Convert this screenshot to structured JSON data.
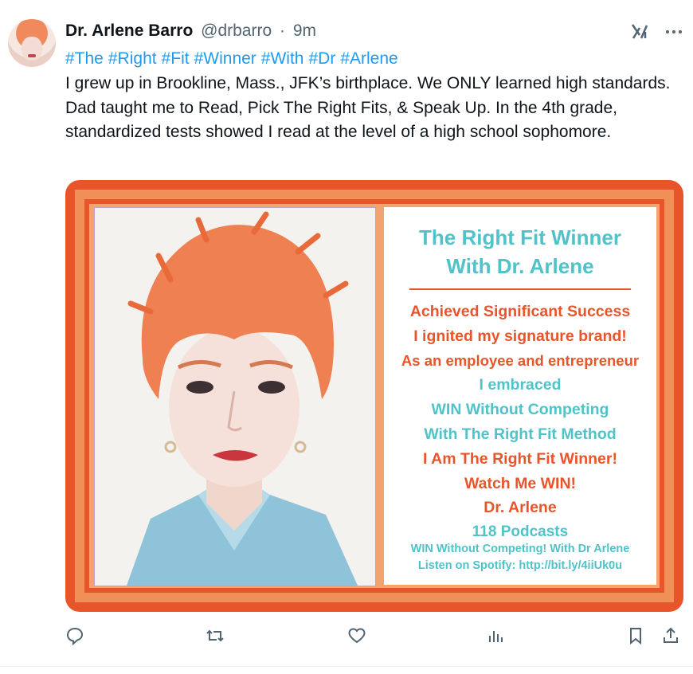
{
  "tweet": {
    "author_name": "Dr. Arlene Barro",
    "author_handle": "@drbarro",
    "separator": "·",
    "time": "9m",
    "hashtags": [
      "#The",
      "#Right",
      "#Fit",
      "#Winner",
      "#With",
      "#Dr",
      "#Arlene"
    ],
    "text": "I grew up in Brookline, Mass., JFK’s birthplace. We ONLY learned high standards. Dad taught me to Read, Pick The Right Fits, & Speak Up. In the 4th grade, standardized tests showed I read at the level of a high school sophomore."
  },
  "media": {
    "title_line1": "The Right Fit Winner",
    "title_line2": "With Dr. Arlene",
    "lines": [
      {
        "text": "Achieved Significant Success",
        "color": "orange"
      },
      {
        "text": "I ignited my signature brand!",
        "color": "orange"
      },
      {
        "text": "As an employee and entrepreneur",
        "color": "orange"
      },
      {
        "text": "I embraced",
        "color": "teal"
      },
      {
        "text": "WIN Without Competing",
        "color": "teal"
      },
      {
        "text": "With The Right Fit Method",
        "color": "teal"
      },
      {
        "text": "I Am The Right Fit Winner!",
        "color": "orange"
      },
      {
        "text": "Watch Me WIN!",
        "color": "orange"
      },
      {
        "text": "Dr. Arlene",
        "color": "orange"
      }
    ],
    "podcasts": "118 Podcasts",
    "small_line1": "WIN Without Competing! With Dr Arlene",
    "small_line2": "Listen on Spotify: http://bit.ly/4iiUk0u"
  },
  "colors": {
    "accent": "#1d9bf0",
    "orange": "#e8552a",
    "teal": "#4fc3c9",
    "muted": "#536471"
  },
  "icons": {
    "header": [
      "grok-icon",
      "more-icon"
    ],
    "actions": [
      "reply-icon",
      "retweet-icon",
      "like-icon",
      "views-icon",
      "bookmark-icon",
      "share-icon"
    ]
  }
}
